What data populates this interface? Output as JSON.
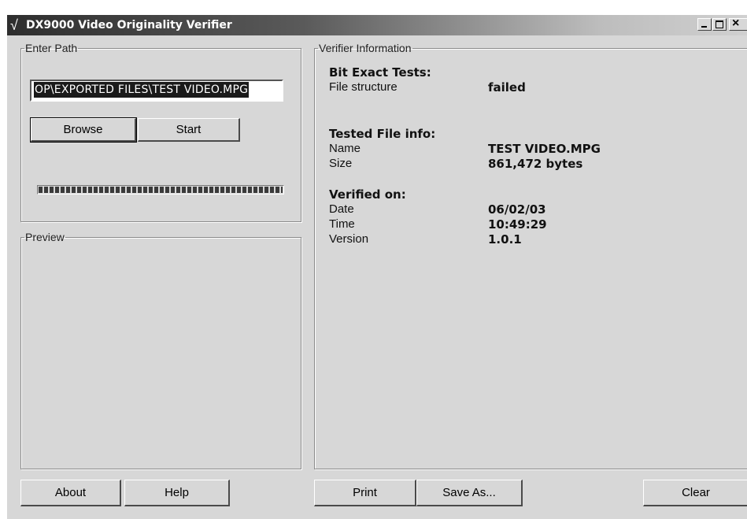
{
  "window": {
    "title": "DX9000 Video Originality Verifier",
    "icon": "checkmark-icon"
  },
  "enter_path": {
    "legend": "Enter Path",
    "path_value": "OP\\EXPORTED FILES\\TEST VIDEO.MPG",
    "browse_label": "Browse",
    "start_label": "Start",
    "progress": 1.0
  },
  "preview": {
    "legend": "Preview"
  },
  "verifier": {
    "legend": "Verifier Information",
    "bit_exact": {
      "heading": "Bit Exact Tests:",
      "file_structure_label": "File structure",
      "file_structure_value": "failed"
    },
    "tested_file": {
      "heading": "Tested File info:",
      "name_label": "Name",
      "name_value": "TEST VIDEO.MPG",
      "size_label": "Size",
      "size_value": "861,472 bytes"
    },
    "verified_on": {
      "heading": "Verified on:",
      "date_label": "Date",
      "date_value": "06/02/03",
      "time_label": "Time",
      "time_value": "10:49:29",
      "version_label": "Version",
      "version_value": "1.0.1"
    }
  },
  "buttons": {
    "about": "About",
    "help": "Help",
    "print": "Print",
    "save_as": "Save As...",
    "clear": "Clear"
  }
}
